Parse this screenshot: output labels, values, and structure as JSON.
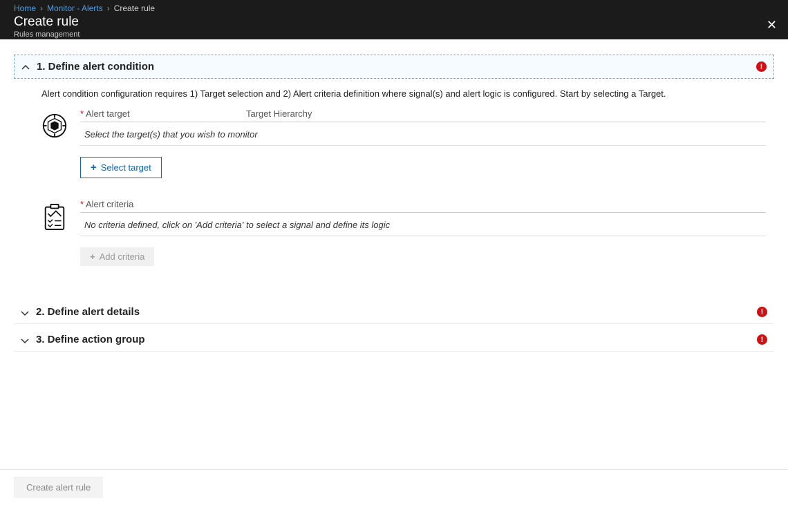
{
  "breadcrumbs": {
    "home": "Home",
    "monitor": "Monitor - Alerts",
    "current": "Create rule"
  },
  "header": {
    "title": "Create rule",
    "subtitle": "Rules management"
  },
  "panels": {
    "condition": {
      "title": "1. Define alert condition",
      "description": "Alert condition configuration requires 1) Target selection and 2) Alert criteria definition where signal(s) and alert logic is configured. Start by selecting a Target.",
      "alert_target_label": "Alert target",
      "target_hierarchy_label": "Target Hierarchy",
      "target_placeholder": "Select the target(s) that you wish to monitor",
      "select_target_button": "Select target",
      "alert_criteria_label": "Alert criteria",
      "criteria_placeholder": "No criteria defined, click on 'Add criteria' to select a signal and define its logic",
      "add_criteria_button": "Add criteria"
    },
    "details": {
      "title": "2. Define alert details"
    },
    "action_group": {
      "title": "3. Define action group"
    }
  },
  "footer": {
    "create_button": "Create alert rule"
  }
}
